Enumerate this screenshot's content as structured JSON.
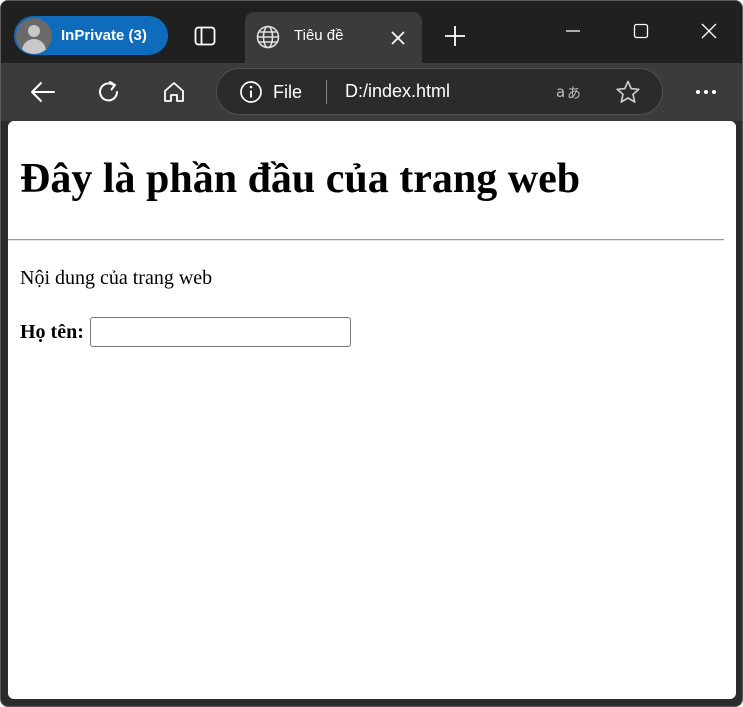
{
  "browser": {
    "profile_label": "InPrivate (3)",
    "tab": {
      "title": "Tiêu đề"
    },
    "address_bar": {
      "scheme_label": "File",
      "url": "D:/index.html"
    },
    "icons": {
      "profile": "avatar-icon",
      "tab_actions": "tab-actions-icon",
      "tab_favicon": "globe-icon",
      "tab_close": "close-icon",
      "new_tab": "plus-icon",
      "minimize": "minimize-icon",
      "maximize": "maximize-icon",
      "close_window": "close-icon",
      "back": "back-arrow-icon",
      "refresh": "refresh-icon",
      "home": "home-icon",
      "site_info": "info-icon",
      "read_aloud": "read-aloud-icon",
      "favorites": "star-icon",
      "more": "more-icon"
    },
    "colors": {
      "title_bar": "#202020",
      "toolbar": "#3b3b3b",
      "profile_pill": "#0f6cbd"
    }
  },
  "page": {
    "heading": "Đây là phần đầu của trang web",
    "content": "Nội dung của trang web",
    "form": {
      "name_label": "Họ tên:",
      "name_value": ""
    }
  }
}
